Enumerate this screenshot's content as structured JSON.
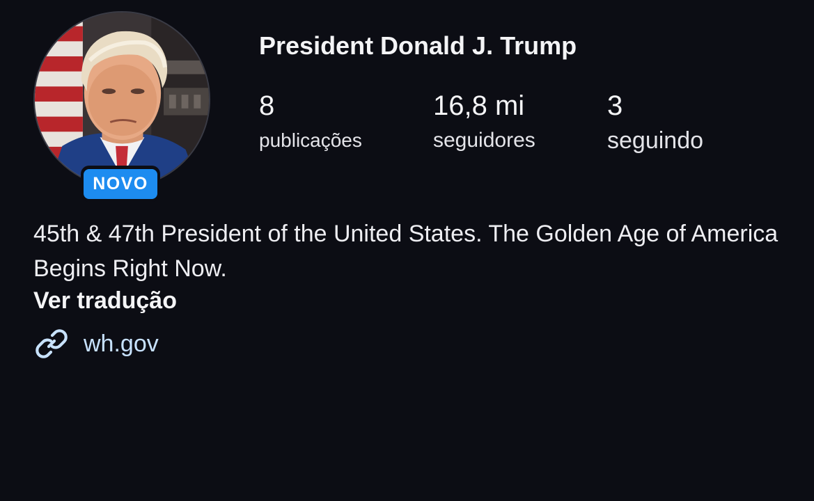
{
  "profile": {
    "name": "President Donald J. Trump",
    "badge": "NOVO",
    "stats": {
      "posts": {
        "value": "8",
        "label": "publicações"
      },
      "followers": {
        "value": "16,8 mi",
        "label": "seguidores"
      },
      "following": {
        "value": "3",
        "label": "seguindo"
      }
    },
    "bio": "45th & 47th President of the United States. The Golden Age of America Begins Right Now.",
    "translate_label": "Ver tradução",
    "link": {
      "icon": "link-icon",
      "text": "wh.gov"
    }
  },
  "colors": {
    "background": "#0c0d14",
    "badge": "#1d8cf0",
    "link": "#c8e2ff",
    "text": "#f4f4f6"
  }
}
